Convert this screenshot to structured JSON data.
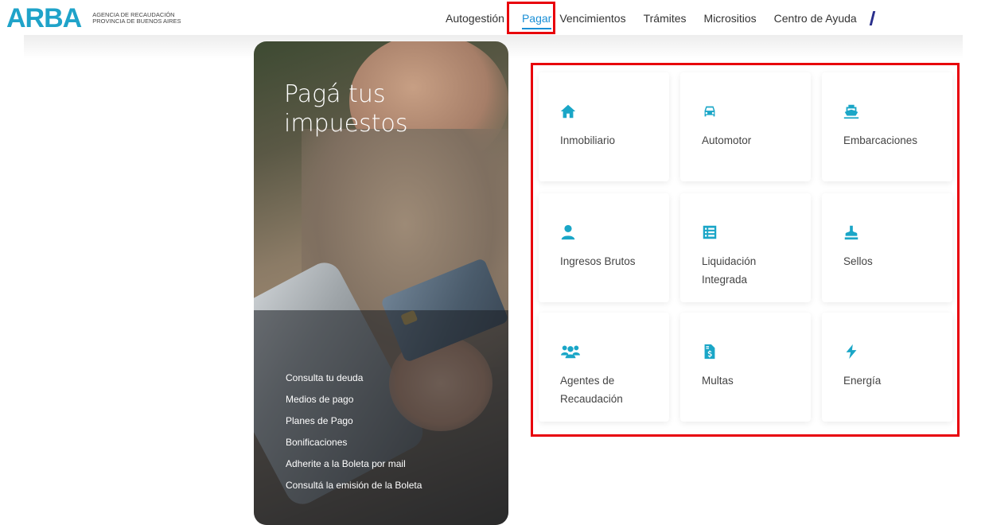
{
  "header": {
    "logo": "ARBA",
    "logo_sub_line1": "AGENCIA DE RECAUDACIÓN",
    "logo_sub_line2": "PROVINCIA DE BUENOS AIRES",
    "nav": [
      "Autogestión",
      "Pagar",
      "Vencimientos",
      "Trámites",
      "Micrositios",
      "Centro de Ayuda"
    ],
    "active_nav": "Pagar"
  },
  "hero": {
    "title": "Pagá tus impuestos",
    "links": [
      "Consulta tu deuda",
      "Medios de pago",
      "Planes de Pago",
      "Bonificaciones",
      "Adherite a la Boleta por mail",
      "Consultá la emisión de la Boleta"
    ]
  },
  "tiles": [
    {
      "label": "Inmobiliario",
      "icon": "home-icon"
    },
    {
      "label": "Automotor",
      "icon": "car-icon"
    },
    {
      "label": "Embarcaciones",
      "icon": "ship-icon"
    },
    {
      "label": "Ingresos Brutos",
      "icon": "user-icon"
    },
    {
      "label": "Liquidación Integrada",
      "icon": "list-icon"
    },
    {
      "label": "Sellos",
      "icon": "stamp-icon"
    },
    {
      "label": "Agentes de Recaudación",
      "icon": "users-icon"
    },
    {
      "label": "Multas",
      "icon": "invoice-dollar-icon"
    },
    {
      "label": "Energía",
      "icon": "bolt-icon"
    }
  ],
  "colors": {
    "brand": "#1fa3c9",
    "icon": "#1aa6c7",
    "active_nav": "#1a8fd6",
    "highlight": "#e8000b"
  }
}
